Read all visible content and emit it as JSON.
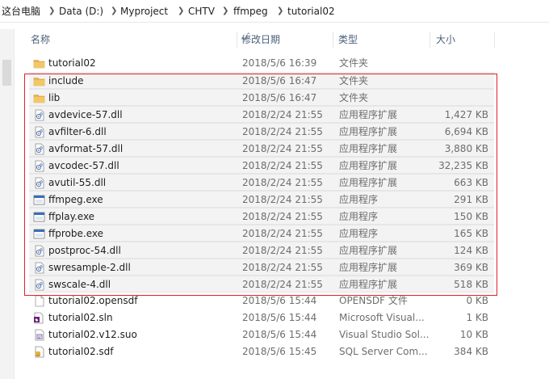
{
  "breadcrumb": [
    "这台电脑",
    "Data (D:)",
    "Myproject",
    "CHTV",
    "ffmpeg",
    "tutorial02"
  ],
  "columns": {
    "name": "名称",
    "date": "修改日期",
    "type": "类型",
    "size": "大小"
  },
  "files": [
    {
      "name": "tutorial02",
      "date": "2018/5/6 16:39",
      "type": "文件夹",
      "size": "",
      "icon": "folder-icon"
    },
    {
      "name": "include",
      "date": "2018/5/6 16:47",
      "type": "文件夹",
      "size": "",
      "icon": "folder-icon"
    },
    {
      "name": "lib",
      "date": "2018/5/6 16:47",
      "type": "文件夹",
      "size": "",
      "icon": "folder-icon"
    },
    {
      "name": "avdevice-57.dll",
      "date": "2018/2/24 21:55",
      "type": "应用程序扩展",
      "size": "1,427 KB",
      "icon": "dll-file-icon"
    },
    {
      "name": "avfilter-6.dll",
      "date": "2018/2/24 21:55",
      "type": "应用程序扩展",
      "size": "6,694 KB",
      "icon": "dll-file-icon"
    },
    {
      "name": "avformat-57.dll",
      "date": "2018/2/24 21:55",
      "type": "应用程序扩展",
      "size": "3,880 KB",
      "icon": "dll-file-icon"
    },
    {
      "name": "avcodec-57.dll",
      "date": "2018/2/24 21:55",
      "type": "应用程序扩展",
      "size": "32,235 KB",
      "icon": "dll-file-icon"
    },
    {
      "name": "avutil-55.dll",
      "date": "2018/2/24 21:55",
      "type": "应用程序扩展",
      "size": "663 KB",
      "icon": "dll-file-icon"
    },
    {
      "name": "ffmpeg.exe",
      "date": "2018/2/24 21:55",
      "type": "应用程序",
      "size": "291 KB",
      "icon": "exe-file-icon"
    },
    {
      "name": "ffplay.exe",
      "date": "2018/2/24 21:55",
      "type": "应用程序",
      "size": "150 KB",
      "icon": "exe-file-icon"
    },
    {
      "name": "ffprobe.exe",
      "date": "2018/2/24 21:55",
      "type": "应用程序",
      "size": "165 KB",
      "icon": "exe-file-icon"
    },
    {
      "name": "postproc-54.dll",
      "date": "2018/2/24 21:55",
      "type": "应用程序扩展",
      "size": "124 KB",
      "icon": "dll-file-icon"
    },
    {
      "name": "swresample-2.dll",
      "date": "2018/2/24 21:55",
      "type": "应用程序扩展",
      "size": "369 KB",
      "icon": "dll-file-icon"
    },
    {
      "name": "swscale-4.dll",
      "date": "2018/2/24 21:55",
      "type": "应用程序扩展",
      "size": "518 KB",
      "icon": "dll-file-icon"
    },
    {
      "name": "tutorial02.opensdf",
      "date": "2018/5/6 15:44",
      "type": "OPENSDF 文件",
      "size": "0 KB",
      "icon": "blank-file-icon"
    },
    {
      "name": "tutorial02.sln",
      "date": "2018/5/6 15:44",
      "type": "Microsoft Visual...",
      "size": "1 KB",
      "icon": "sln-file-icon"
    },
    {
      "name": "tutorial02.v12.suo",
      "date": "2018/5/6 15:44",
      "type": "Visual Studio Sol...",
      "size": "10 KB",
      "icon": "suo-file-icon"
    },
    {
      "name": "tutorial02.sdf",
      "date": "2018/5/6 15:45",
      "type": "SQL Server Com...",
      "size": "384 KB",
      "icon": "sdf-file-icon"
    }
  ],
  "colors": {
    "highlight_box": "#e0202c",
    "folder": "#e8b64c",
    "selected_row": "#f3f3f3"
  }
}
